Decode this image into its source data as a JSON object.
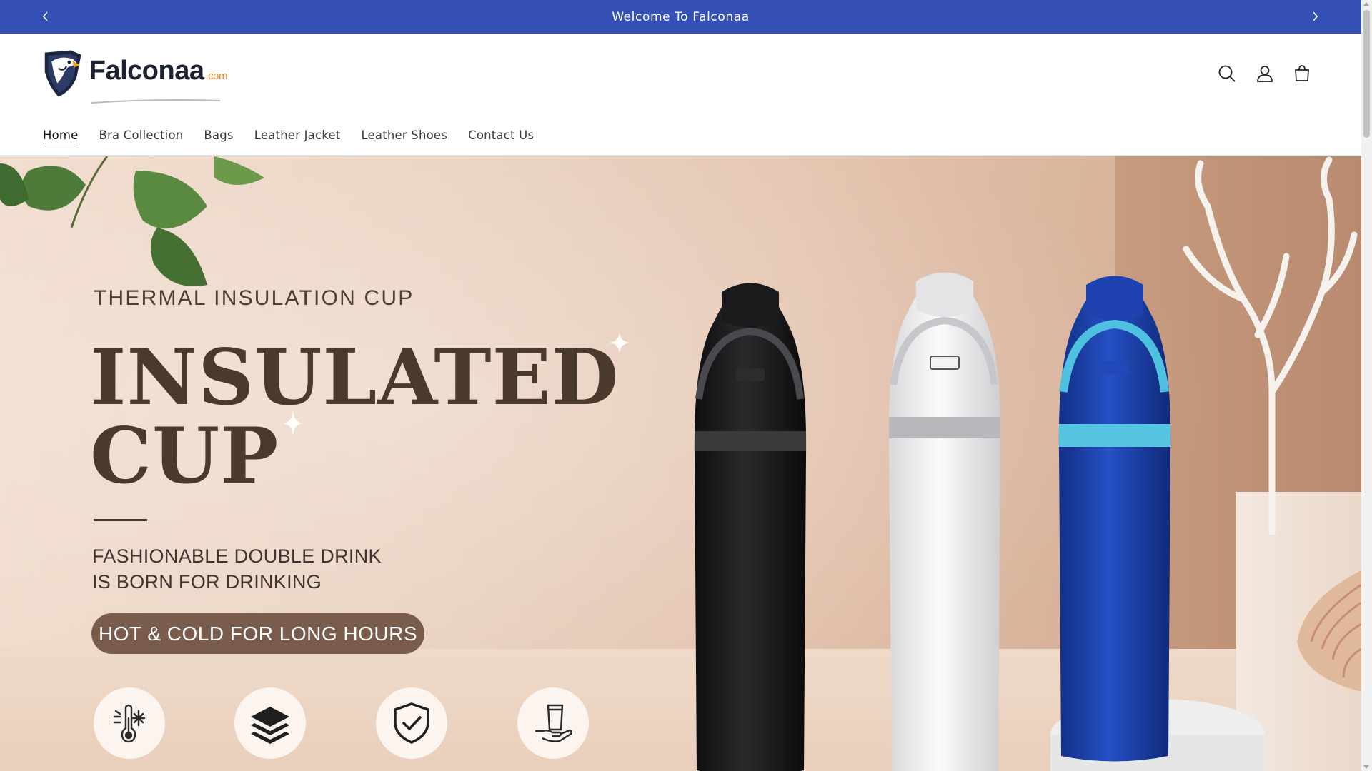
{
  "announcement": {
    "message": "Welcome To Falconaa",
    "prev_icon": "chevron-left-icon",
    "next_icon": "chevron-right-icon",
    "bg_color": "#3550b5"
  },
  "brand": {
    "name": "Falconaa",
    "tld": ".com"
  },
  "header_icons": [
    "search-icon",
    "account-icon",
    "cart-icon"
  ],
  "nav": {
    "items": [
      {
        "label": "Home",
        "active": true
      },
      {
        "label": "Bra Collection"
      },
      {
        "label": "Bags"
      },
      {
        "label": "Leather Jacket"
      },
      {
        "label": "Leather Shoes"
      },
      {
        "label": "Contact Us"
      }
    ]
  },
  "hero": {
    "subtitle": "THERMAL INSULATION CUP",
    "headline_line1": "INSULATED",
    "headline_line2": "CUP",
    "tagline_line1": "FASHIONABLE DOUBLE DRINK",
    "tagline_line2": "IS BORN FOR DRINKING",
    "pill_text": "HOT & COLD FOR LONG HOURS",
    "features": [
      "thermometer-snowflake-icon",
      "layers-icon",
      "shield-check-icon",
      "cup-hand-icon"
    ],
    "bottle_colors": [
      "#1c1c1e",
      "#f2f2f2",
      "#1a3a9a"
    ],
    "accent_color": "#7a5c4d"
  }
}
